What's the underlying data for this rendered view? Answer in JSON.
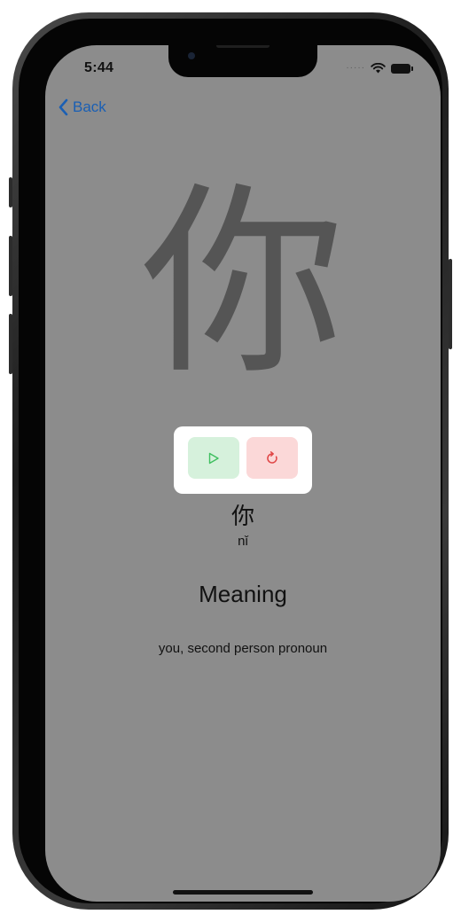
{
  "status_bar": {
    "time": "5:44",
    "signal_icon": "cellular-dots-icon",
    "wifi_icon": "wifi-icon",
    "battery_icon": "battery-icon"
  },
  "nav": {
    "back_label": "Back",
    "back_icon": "chevron-left-icon"
  },
  "character": {
    "hanzi": "你",
    "pinyin": "nǐ"
  },
  "controls": {
    "play_icon": "play-icon",
    "reset_icon": "refresh-icon"
  },
  "meaning": {
    "heading": "Meaning",
    "text": "you, second person pronoun"
  },
  "colors": {
    "screen_background": "#8c8c8c",
    "link_blue": "#1a5fb4",
    "play_button_bg": "#d6f1dc",
    "play_icon_color": "#3fbf5f",
    "reset_button_bg": "#fbd8d8",
    "reset_icon_color": "#e04545",
    "stroke_character_color": "#555555"
  }
}
